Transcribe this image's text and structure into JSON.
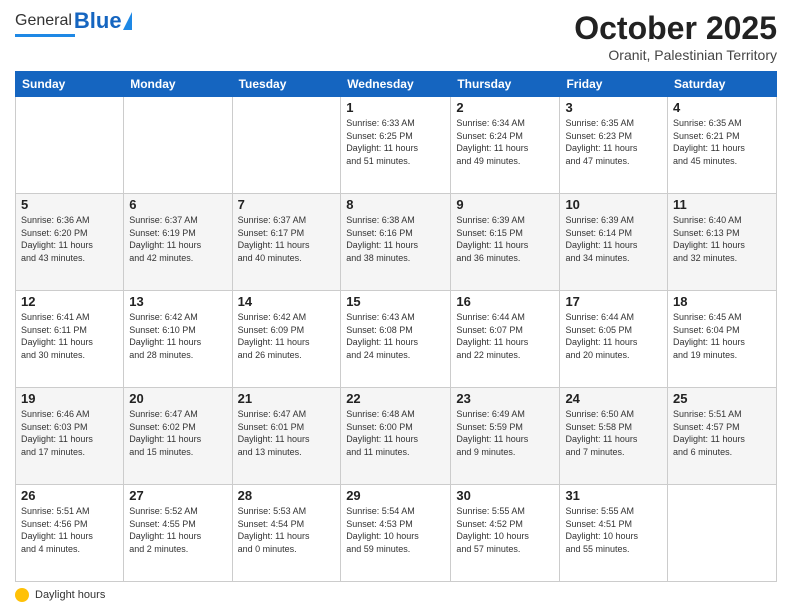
{
  "header": {
    "logo_general": "General",
    "logo_blue": "Blue",
    "month_title": "October 2025",
    "subtitle": "Oranit, Palestinian Territory"
  },
  "days_of_week": [
    "Sunday",
    "Monday",
    "Tuesday",
    "Wednesday",
    "Thursday",
    "Friday",
    "Saturday"
  ],
  "footer_label": "Daylight hours",
  "weeks": [
    [
      {
        "num": "",
        "info": ""
      },
      {
        "num": "",
        "info": ""
      },
      {
        "num": "",
        "info": ""
      },
      {
        "num": "1",
        "info": "Sunrise: 6:33 AM\nSunset: 6:25 PM\nDaylight: 11 hours\nand 51 minutes."
      },
      {
        "num": "2",
        "info": "Sunrise: 6:34 AM\nSunset: 6:24 PM\nDaylight: 11 hours\nand 49 minutes."
      },
      {
        "num": "3",
        "info": "Sunrise: 6:35 AM\nSunset: 6:23 PM\nDaylight: 11 hours\nand 47 minutes."
      },
      {
        "num": "4",
        "info": "Sunrise: 6:35 AM\nSunset: 6:21 PM\nDaylight: 11 hours\nand 45 minutes."
      }
    ],
    [
      {
        "num": "5",
        "info": "Sunrise: 6:36 AM\nSunset: 6:20 PM\nDaylight: 11 hours\nand 43 minutes."
      },
      {
        "num": "6",
        "info": "Sunrise: 6:37 AM\nSunset: 6:19 PM\nDaylight: 11 hours\nand 42 minutes."
      },
      {
        "num": "7",
        "info": "Sunrise: 6:37 AM\nSunset: 6:17 PM\nDaylight: 11 hours\nand 40 minutes."
      },
      {
        "num": "8",
        "info": "Sunrise: 6:38 AM\nSunset: 6:16 PM\nDaylight: 11 hours\nand 38 minutes."
      },
      {
        "num": "9",
        "info": "Sunrise: 6:39 AM\nSunset: 6:15 PM\nDaylight: 11 hours\nand 36 minutes."
      },
      {
        "num": "10",
        "info": "Sunrise: 6:39 AM\nSunset: 6:14 PM\nDaylight: 11 hours\nand 34 minutes."
      },
      {
        "num": "11",
        "info": "Sunrise: 6:40 AM\nSunset: 6:13 PM\nDaylight: 11 hours\nand 32 minutes."
      }
    ],
    [
      {
        "num": "12",
        "info": "Sunrise: 6:41 AM\nSunset: 6:11 PM\nDaylight: 11 hours\nand 30 minutes."
      },
      {
        "num": "13",
        "info": "Sunrise: 6:42 AM\nSunset: 6:10 PM\nDaylight: 11 hours\nand 28 minutes."
      },
      {
        "num": "14",
        "info": "Sunrise: 6:42 AM\nSunset: 6:09 PM\nDaylight: 11 hours\nand 26 minutes."
      },
      {
        "num": "15",
        "info": "Sunrise: 6:43 AM\nSunset: 6:08 PM\nDaylight: 11 hours\nand 24 minutes."
      },
      {
        "num": "16",
        "info": "Sunrise: 6:44 AM\nSunset: 6:07 PM\nDaylight: 11 hours\nand 22 minutes."
      },
      {
        "num": "17",
        "info": "Sunrise: 6:44 AM\nSunset: 6:05 PM\nDaylight: 11 hours\nand 20 minutes."
      },
      {
        "num": "18",
        "info": "Sunrise: 6:45 AM\nSunset: 6:04 PM\nDaylight: 11 hours\nand 19 minutes."
      }
    ],
    [
      {
        "num": "19",
        "info": "Sunrise: 6:46 AM\nSunset: 6:03 PM\nDaylight: 11 hours\nand 17 minutes."
      },
      {
        "num": "20",
        "info": "Sunrise: 6:47 AM\nSunset: 6:02 PM\nDaylight: 11 hours\nand 15 minutes."
      },
      {
        "num": "21",
        "info": "Sunrise: 6:47 AM\nSunset: 6:01 PM\nDaylight: 11 hours\nand 13 minutes."
      },
      {
        "num": "22",
        "info": "Sunrise: 6:48 AM\nSunset: 6:00 PM\nDaylight: 11 hours\nand 11 minutes."
      },
      {
        "num": "23",
        "info": "Sunrise: 6:49 AM\nSunset: 5:59 PM\nDaylight: 11 hours\nand 9 minutes."
      },
      {
        "num": "24",
        "info": "Sunrise: 6:50 AM\nSunset: 5:58 PM\nDaylight: 11 hours\nand 7 minutes."
      },
      {
        "num": "25",
        "info": "Sunrise: 5:51 AM\nSunset: 4:57 PM\nDaylight: 11 hours\nand 6 minutes."
      }
    ],
    [
      {
        "num": "26",
        "info": "Sunrise: 5:51 AM\nSunset: 4:56 PM\nDaylight: 11 hours\nand 4 minutes."
      },
      {
        "num": "27",
        "info": "Sunrise: 5:52 AM\nSunset: 4:55 PM\nDaylight: 11 hours\nand 2 minutes."
      },
      {
        "num": "28",
        "info": "Sunrise: 5:53 AM\nSunset: 4:54 PM\nDaylight: 11 hours\nand 0 minutes."
      },
      {
        "num": "29",
        "info": "Sunrise: 5:54 AM\nSunset: 4:53 PM\nDaylight: 10 hours\nand 59 minutes."
      },
      {
        "num": "30",
        "info": "Sunrise: 5:55 AM\nSunset: 4:52 PM\nDaylight: 10 hours\nand 57 minutes."
      },
      {
        "num": "31",
        "info": "Sunrise: 5:55 AM\nSunset: 4:51 PM\nDaylight: 10 hours\nand 55 minutes."
      },
      {
        "num": "",
        "info": ""
      }
    ]
  ]
}
